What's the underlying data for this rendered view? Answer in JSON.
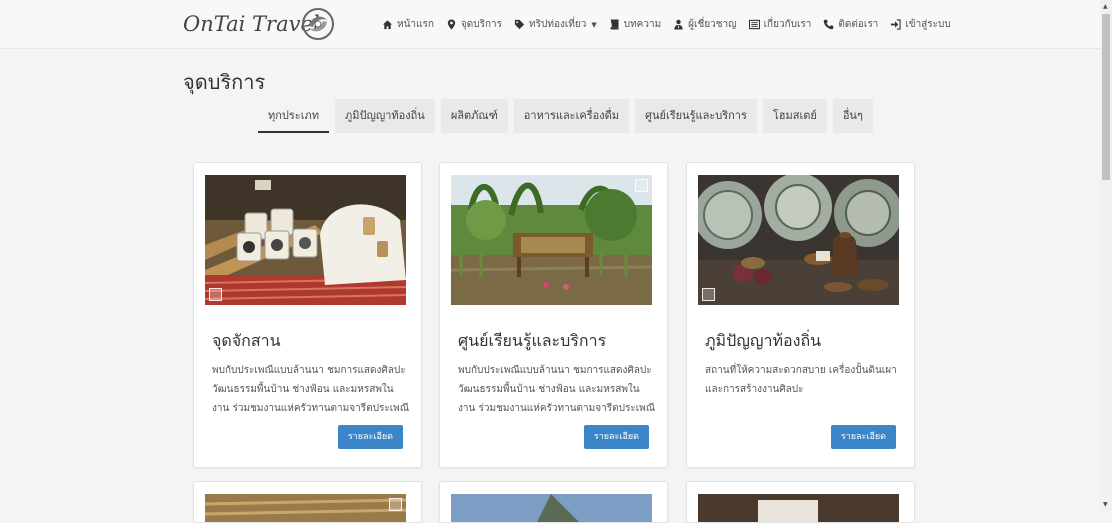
{
  "brand": {
    "name": "OnTai Travel"
  },
  "nav": [
    {
      "label": "หน้าแรก",
      "icon": "home-icon"
    },
    {
      "label": "จุดบริการ",
      "icon": "map-marker-icon"
    },
    {
      "label": "ทริปท่องเที่ยว",
      "icon": "tag-icon",
      "dropdown": true
    },
    {
      "label": "บทความ",
      "icon": "book-icon"
    },
    {
      "label": "ผู้เชี่ยวชาญ",
      "icon": "user-tie-icon"
    },
    {
      "label": "เกี่ยวกับเรา",
      "icon": "list-icon"
    },
    {
      "label": "ติดต่อเรา",
      "icon": "phone-icon"
    },
    {
      "label": "เข้าสู่ระบบ",
      "icon": "login-icon"
    }
  ],
  "page": {
    "title": "จุดบริการ"
  },
  "tabs": [
    {
      "label": "ทุกประเภท",
      "active": true
    },
    {
      "label": "ภูมิปัญญาท้องถิ่น"
    },
    {
      "label": "ผลิตภัณฑ์"
    },
    {
      "label": "อาหารและเครื่องดื่ม"
    },
    {
      "label": "ศูนย์เรียนรู้และบริการ"
    },
    {
      "label": "โฮมสเตย์"
    },
    {
      "label": "อื่นๆ"
    }
  ],
  "cards": [
    {
      "title": "จุดจักสาน",
      "description": "พบกับประเพณีแบบล้านนา ชมการแสดงศิลปะวัฒนธรรมพื้นบ้าน ช่างฟ้อน และมหรสพในงาน ร่วมชมงานแห่ครัวทานตามจารีตประเพณี ดื่ม",
      "button": "รายละเอียด"
    },
    {
      "title": "ศูนย์เรียนรู้และบริการ",
      "description": "พบกับประเพณีแบบล้านนา ชมการแสดงศิลปะวัฒนธรรมพื้นบ้าน ช่างฟ้อน และมหรสพในงาน ร่วมชมงานแห่ครัวทานตามจารีตประเพณี ดื่ม",
      "button": "รายละเอียด"
    },
    {
      "title": "ภูมิปัญญาท้องถิ่น",
      "description": "สถานที่ให้ความสะดวกสบาย เครื่องปั้นดินเผาและการสร้างงานศิลปะ",
      "button": "รายละเอียด"
    }
  ],
  "colors": {
    "accent": "#3a86c8",
    "page_bg": "#f4f4f4",
    "nav_bg": "#f8f8f8",
    "card_bg": "#ffffff"
  }
}
